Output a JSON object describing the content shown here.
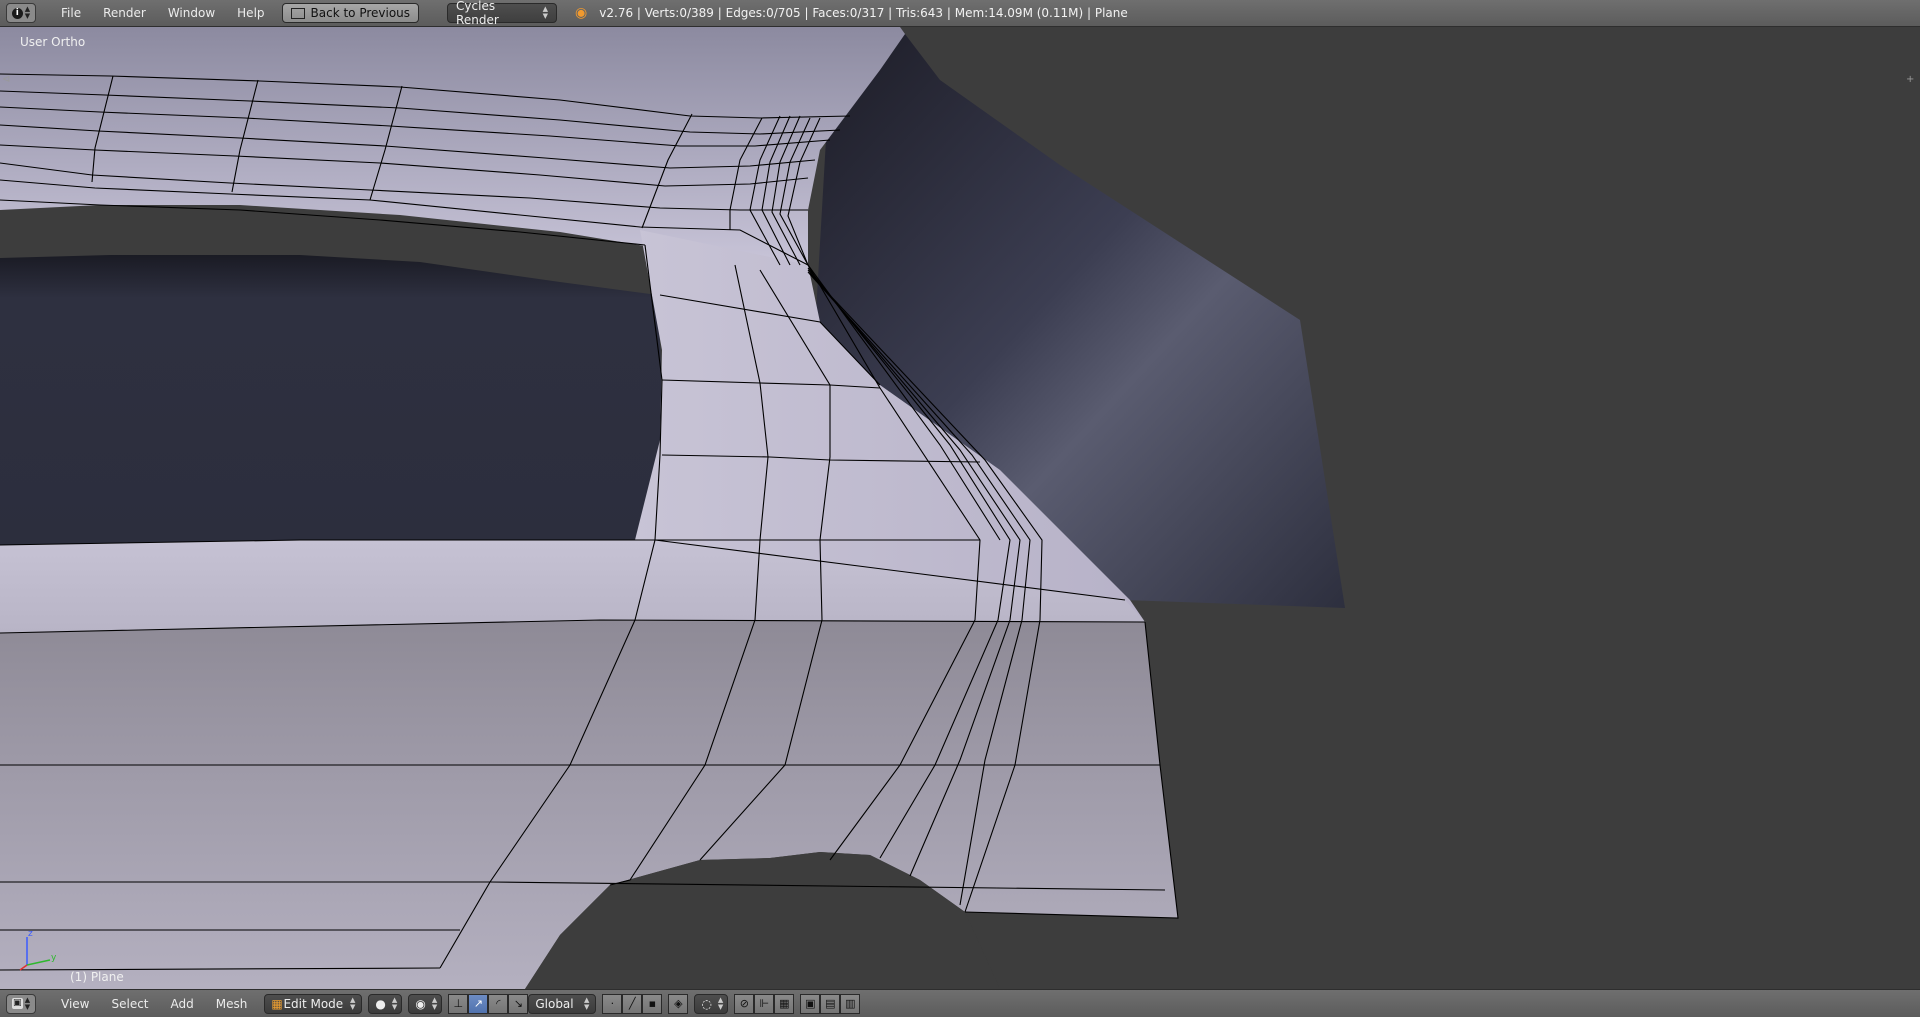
{
  "header": {
    "menu": [
      "File",
      "Render",
      "Window",
      "Help"
    ],
    "back_button": "Back to Previous",
    "render_engine": "Cycles Render",
    "stats": "v2.76 | Verts:0/389 | Edges:0/705 | Faces:0/317 | Tris:643 | Mem:14.09M (0.11M) | Plane"
  },
  "viewport": {
    "view_label": "User Ortho",
    "object_label": "(1) Plane"
  },
  "footer": {
    "menu": [
      "View",
      "Select",
      "Add",
      "Mesh"
    ],
    "mode": "Edit Mode",
    "orientation": "Global"
  },
  "colors": {
    "background": "#3d3d3d",
    "header": "#666666",
    "mesh_light": "#bdb8ce",
    "mesh_dark": "#2f3040",
    "wire": "#000000"
  }
}
